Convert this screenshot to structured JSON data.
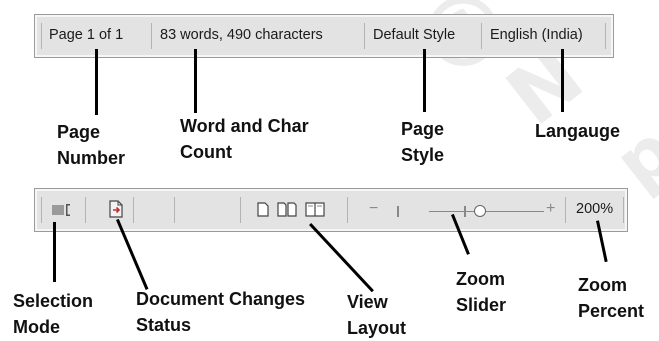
{
  "status_bar_top": {
    "page_number": "Page 1 of 1",
    "word_count": "83 words, 490 characters",
    "page_style": "Default Style",
    "language": "English (India)"
  },
  "status_bar_bottom": {
    "selection_mode_icon": "selection-mode-icon",
    "document_changes_icon": "document-modified-icon",
    "view_layout_icons": [
      "single-page-view-icon",
      "multi-page-view-icon",
      "book-view-icon"
    ],
    "zoom_out_symbol": "−",
    "zoom_in_symbol": "+",
    "zoom_level_percent": 200,
    "zoom_percent": "200%"
  },
  "labels": {
    "page_number": [
      "Page",
      "Number"
    ],
    "word_char_count": [
      "Word and Char",
      "Count"
    ],
    "page_style": [
      "Page",
      "Style"
    ],
    "language": [
      "Langauge"
    ],
    "selection_mode": [
      "Selection",
      "Mode"
    ],
    "document_changes": [
      "Document Changes",
      "Status"
    ],
    "view_layout": [
      "View",
      "Layout"
    ],
    "zoom_slider": [
      "Zoom",
      "Slider"
    ],
    "zoom_percent": [
      "Zoom",
      "Percent"
    ]
  }
}
